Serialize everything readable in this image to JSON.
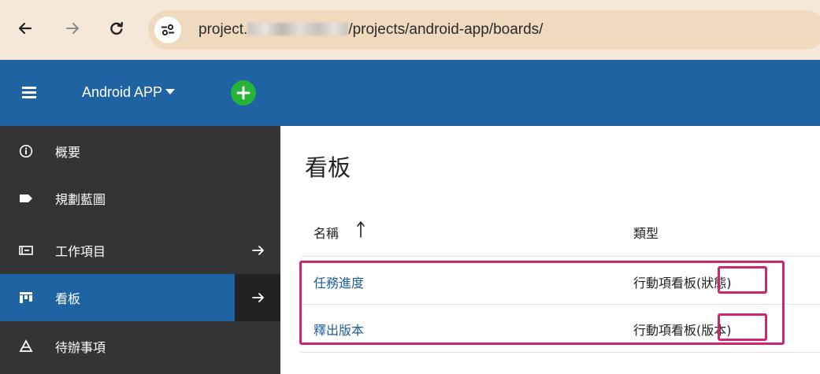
{
  "browser": {
    "url_prefix": "project.",
    "url_suffix": "/projects/android-app/boards/"
  },
  "header": {
    "project_name": "Android APP"
  },
  "sidebar": {
    "items": [
      {
        "label": "概要",
        "icon": "info-icon"
      },
      {
        "label": "規劃藍圖",
        "icon": "label-tag-icon"
      },
      {
        "label": "工作項目",
        "icon": "work-items-icon",
        "has_arrow": true
      },
      {
        "label": "看板",
        "icon": "board-icon",
        "has_arrow": true,
        "active": true
      },
      {
        "label": "待辦事項",
        "icon": "backlog-icon"
      }
    ]
  },
  "main": {
    "title": "看板",
    "columns": [
      "名稱",
      "類型"
    ],
    "rows": [
      {
        "name": "任務進度",
        "type_text": "行動項看板",
        "type_paren": "(狀態)"
      },
      {
        "name": "釋出版本",
        "type_text": "行動項看板",
        "type_paren": "(版本)"
      }
    ]
  },
  "colors": {
    "header_blue": "#1f63a2",
    "sidebar_dark": "#343434",
    "highlight_magenta": "#d1246f",
    "add_green": "#27b33a",
    "browser_bar": "#f6e8d8"
  }
}
